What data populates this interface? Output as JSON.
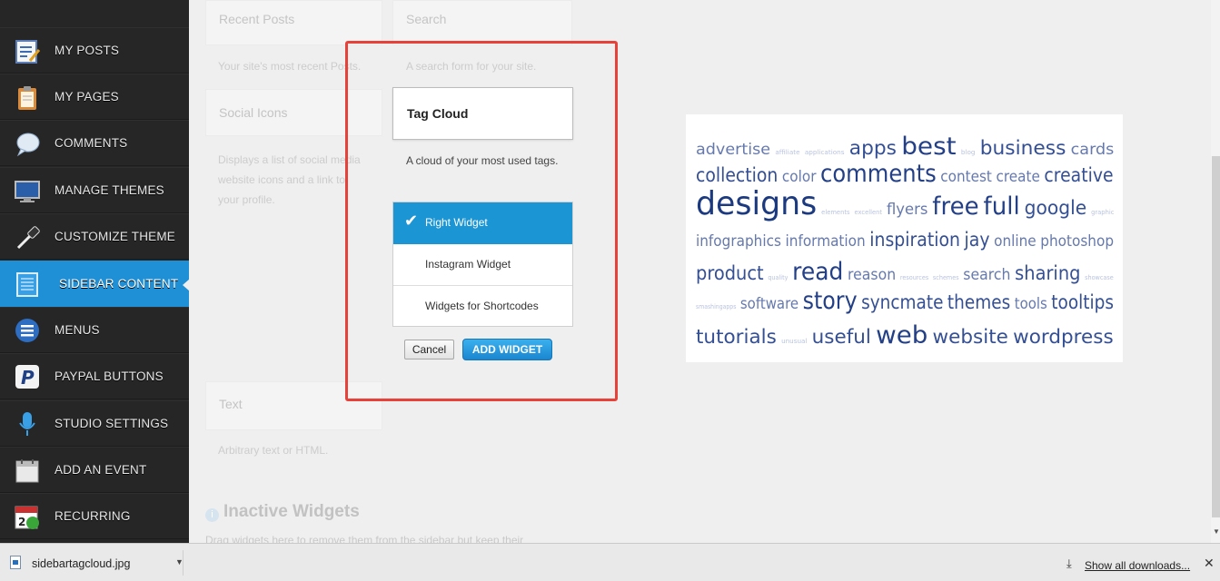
{
  "sidebar": {
    "items": [
      {
        "label": "MY POSTS",
        "icon": "notepad-icon"
      },
      {
        "label": "MY PAGES",
        "icon": "clipboard-icon"
      },
      {
        "label": "COMMENTS",
        "icon": "speech-bubble-icon"
      },
      {
        "label": "MANAGE THEMES",
        "icon": "monitor-icon"
      },
      {
        "label": "CUSTOMIZE THEME",
        "icon": "eyedropper-icon"
      },
      {
        "label": "SIDEBAR CONTENT",
        "icon": "sidebar-layout-icon",
        "active": true
      },
      {
        "label": "MENUS",
        "icon": "list-icon"
      },
      {
        "label": "PAYPAL BUTTONS",
        "icon": "paypal-icon"
      },
      {
        "label": "STUDIO SETTINGS",
        "icon": "microphone-icon"
      },
      {
        "label": "ADD AN EVENT",
        "icon": "calendar-icon"
      },
      {
        "label": "RECURRING",
        "icon": "recurring-calendar-icon"
      }
    ]
  },
  "widgets": {
    "recent_posts": {
      "title": "Recent Posts",
      "desc": "Your site's most recent Posts."
    },
    "search": {
      "title": "Search",
      "desc": "A search form for your site."
    },
    "social_icons": {
      "title": "Social Icons",
      "desc_lines": [
        "Displays a list of social media",
        "website icons and a link to",
        "your profile."
      ]
    },
    "text": {
      "title": "Text",
      "desc": "Arbitrary text or HTML."
    },
    "inactive": {
      "title": "Inactive Widgets",
      "desc": "Drag widgets here to remove them from the sidebar but keep their"
    }
  },
  "dialog": {
    "widget_title": "Tag Cloud",
    "widget_desc": "A cloud of your most used tags.",
    "options": [
      {
        "label": "Right Widget",
        "selected": true
      },
      {
        "label": "Instagram Widget",
        "selected": false
      },
      {
        "label": "Widgets for Shortcodes",
        "selected": false
      }
    ],
    "cancel_label": "Cancel",
    "add_label": "ADD WIDGET",
    "highlight_color": "#e8413a"
  },
  "tag_cloud": {
    "lines": [
      [
        {
          "w": "advertise",
          "s": 3
        },
        {
          "w": "affiliate",
          "s": 1
        },
        {
          "w": "applications",
          "s": 1
        },
        {
          "w": "apps",
          "s": 4
        },
        {
          "w": "best",
          "s": 5
        },
        {
          "w": "blog",
          "s": 1
        },
        {
          "w": "business",
          "s": 4
        },
        {
          "w": "cards",
          "s": 3
        }
      ],
      [
        {
          "w": "collection",
          "s": 4
        },
        {
          "w": "color",
          "s": 3
        },
        {
          "w": "comments",
          "s": 5
        },
        {
          "w": "contest",
          "s": 3
        },
        {
          "w": "create",
          "s": 3
        },
        {
          "w": "creative",
          "s": 4
        }
      ],
      [
        {
          "w": "designs",
          "s": 6
        },
        {
          "w": "elements",
          "s": 1
        },
        {
          "w": "excellent",
          "s": 1
        },
        {
          "w": "flyers",
          "s": 3
        },
        {
          "w": "free",
          "s": 5
        },
        {
          "w": "full",
          "s": 5
        },
        {
          "w": "google",
          "s": 4
        },
        {
          "w": "graphic",
          "s": 1
        }
      ],
      [
        {
          "w": "infographics",
          "s": 3
        },
        {
          "w": "information",
          "s": 3
        },
        {
          "w": "inspiration",
          "s": 4
        },
        {
          "w": "jay",
          "s": 4
        },
        {
          "w": "online",
          "s": 3
        },
        {
          "w": "photoshop",
          "s": 3
        }
      ],
      [
        {
          "w": "product",
          "s": 4
        },
        {
          "w": "quality",
          "s": 1
        },
        {
          "w": "read",
          "s": 5
        },
        {
          "w": "reason",
          "s": 3
        },
        {
          "w": "resources",
          "s": 1
        },
        {
          "w": "schemes",
          "s": 1
        },
        {
          "w": "search",
          "s": 3
        },
        {
          "w": "sharing",
          "s": 4
        },
        {
          "w": "showcase",
          "s": 1
        }
      ],
      [
        {
          "w": "smashingapps",
          "s": 1
        },
        {
          "w": "software",
          "s": 3
        },
        {
          "w": "story",
          "s": 5
        },
        {
          "w": "syncmate",
          "s": 4
        },
        {
          "w": "themes",
          "s": 4
        },
        {
          "w": "tools",
          "s": 3
        },
        {
          "w": "tooltips",
          "s": 4
        }
      ],
      [
        {
          "w": "tutorials",
          "s": 4
        },
        {
          "w": "unusual",
          "s": 1
        },
        {
          "w": "useful",
          "s": 4
        },
        {
          "w": "web",
          "s": 5
        },
        {
          "w": "website",
          "s": 4
        },
        {
          "w": "wordpress",
          "s": 4
        }
      ]
    ]
  },
  "downloads": {
    "file_name": "sidebartagcloud.jpg",
    "show_all_label": "Show all downloads...",
    "close_symbol": "✕"
  }
}
